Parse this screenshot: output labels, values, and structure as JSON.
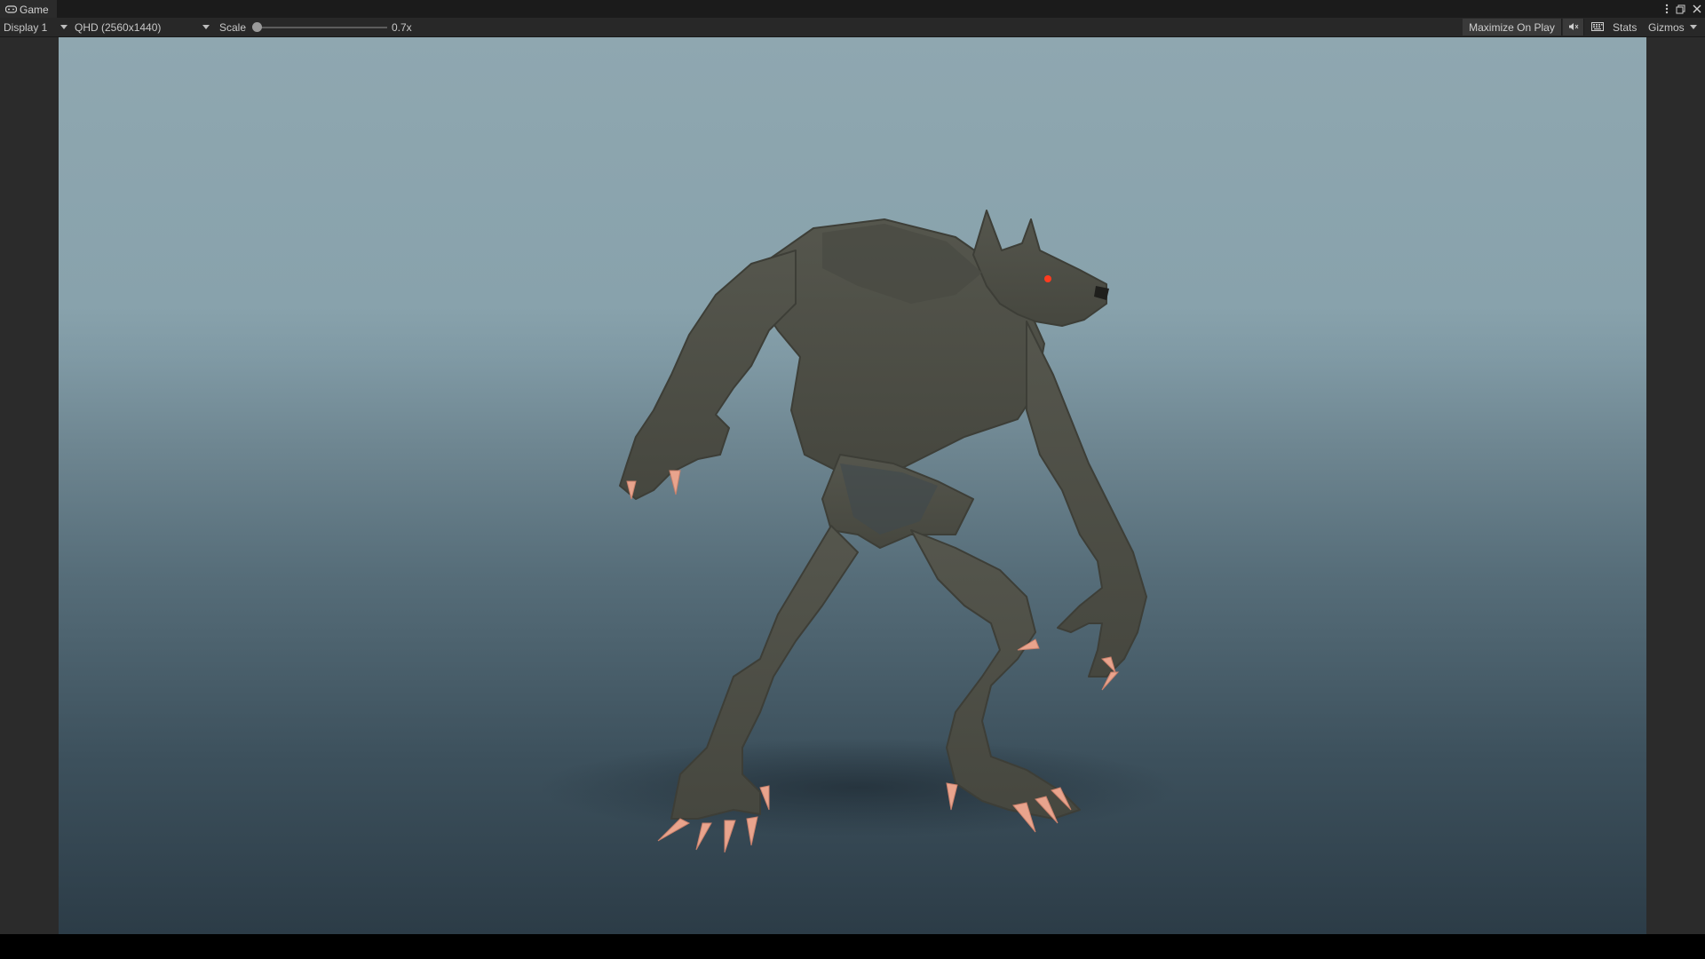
{
  "tab": {
    "label": "Game",
    "icon": "gamepad-icon"
  },
  "window_controls": {
    "menu_icon": "kebab-menu-icon",
    "maximize_icon": "maximize-icon",
    "close_icon": "close-icon"
  },
  "toolbar": {
    "display": "Display 1",
    "resolution": "QHD (2560x1440)",
    "scale_label": "Scale",
    "scale_value": "0.7x",
    "scale_fraction": 0.0,
    "maximize_on_play": "Maximize On Play",
    "mute_icon": "mute-audio-icon",
    "shortcuts_icon": "keyboard-icon",
    "stats": "Stats",
    "gizmos": "Gizmos"
  },
  "viewport": {
    "scene": "werewolf-character",
    "eye_color": "#ff3b1f",
    "claw_color": "#e9a48d",
    "fur_color": "#4f5048"
  }
}
